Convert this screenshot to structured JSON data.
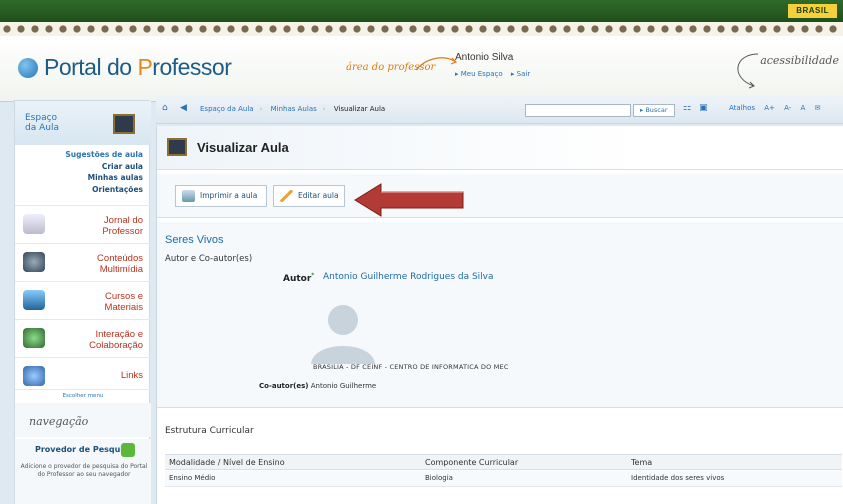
{
  "topbar": {
    "badge": "BRASIL"
  },
  "header": {
    "logo_text_a": "Portal do ",
    "logo_text_b": "P",
    "logo_text_c": "rofessor",
    "area": "área do professor",
    "user_name": "Antonio Silva",
    "user_links": [
      "▸ Meu Espaço",
      "▸ Sair"
    ],
    "acessibilidade": "acessibilidade"
  },
  "sidebar": {
    "espaco": [
      "Espaço",
      "da Aula"
    ],
    "sub_links": [
      "Sugestões de aula",
      "Criar aula",
      "Minhas aulas",
      "Orientações"
    ],
    "sections": [
      {
        "label": [
          "Jornal do",
          "Professor"
        ],
        "icon": "newspaper-icon"
      },
      {
        "label": [
          "Conteúdos",
          "Multimídia"
        ],
        "icon": "multimedia-icon"
      },
      {
        "label": [
          "Cursos e",
          "Materiais"
        ],
        "icon": "books-icon"
      },
      {
        "label": [
          "Interação e",
          "Colaboração"
        ],
        "icon": "collaboration-icon"
      },
      {
        "label": [
          "Links"
        ],
        "icon": "globe-icon"
      }
    ],
    "escolher": "Escolher menu",
    "navegacao": "navegação",
    "provedor_title": "Provedor de Pesquisa",
    "provedor_desc": "Adicione o provedor de pesquisa do Portal do Professor ao seu navegador"
  },
  "breadcrumb": {
    "items": [
      "Espaço da Aula",
      "Minhas Aulas",
      "Visualizar Aula"
    ],
    "search_placeholder": "",
    "buscar": "▸ Buscar",
    "atalhos": [
      "Atalhos",
      "A+",
      "A-",
      "A"
    ]
  },
  "page": {
    "title": "Visualizar Aula",
    "print_button": "Imprimir a aula",
    "edit_button": "Editar aula"
  },
  "aula": {
    "heading": "Seres Vivos",
    "autores_label": "Autor e Co-autor(es)",
    "autor_label": "Autor",
    "autor_marker": "*",
    "autor_name": "Antonio Guilherme Rodrigues da Silva",
    "institution": "BRASILIA - DF CEINF - CENTRO DE INFORMATICA DO MEC",
    "coautor_label": "Co-autor(es)",
    "coautor_name": "Antonio Guilherme"
  },
  "estrutura": {
    "heading": "Estrutura Curricular",
    "columns": [
      "Modalidade / Nível de Ensino",
      "Componente Curricular",
      "Tema"
    ],
    "rows": [
      [
        "Ensino Médio",
        "Biologia",
        "Identidade dos seres vivos"
      ]
    ]
  },
  "colors": {
    "brand_blue": "#1e5b86",
    "accent_orange": "#e08b1c",
    "arrow_red": "#b33a35"
  }
}
